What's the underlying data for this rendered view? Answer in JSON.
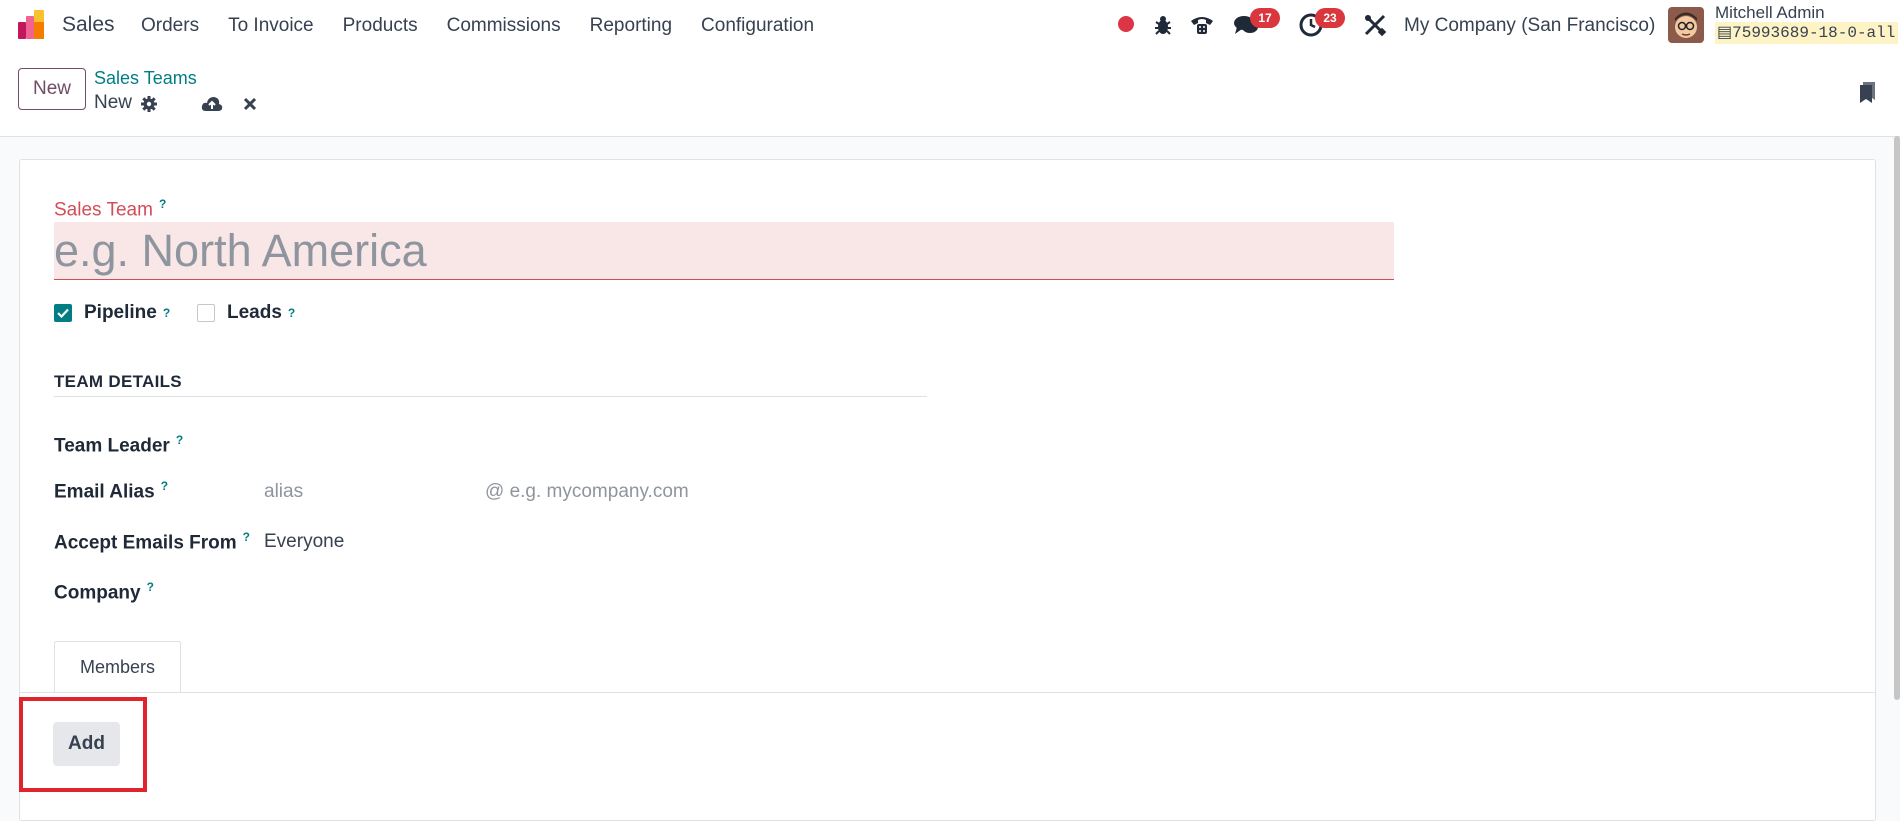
{
  "navbar": {
    "app_name": "Sales",
    "menu": [
      "Orders",
      "To Invoice",
      "Products",
      "Commissions",
      "Reporting",
      "Configuration"
    ],
    "messages_count": "17",
    "activities_count": "23",
    "company": "My Company (San Francisco)",
    "user_name": "Mitchell Admin",
    "db_name": "75993689-18-0-all"
  },
  "control_panel": {
    "new_label": "New",
    "breadcrumb_parent": "Sales Teams",
    "breadcrumb_current": "New"
  },
  "form": {
    "name_label": "Sales Team",
    "name_placeholder": "e.g. North America",
    "help_mark": "?",
    "pipeline_label": "Pipeline",
    "pipeline_checked": true,
    "leads_label": "Leads",
    "leads_checked": false,
    "section_title": "TEAM DETAILS",
    "team_leader_label": "Team Leader",
    "email_alias_label": "Email Alias",
    "alias_placeholder": "alias",
    "domain_placeholder": "@ e.g. mycompany.com",
    "accept_emails_label": "Accept Emails From",
    "accept_emails_value": "Everyone",
    "company_label": "Company",
    "tab_members": "Members",
    "add_label": "Add"
  },
  "colors": {
    "brand": "#714b67",
    "link": "#017e84",
    "required": "#d44c59",
    "highlight": "#e0242d"
  }
}
